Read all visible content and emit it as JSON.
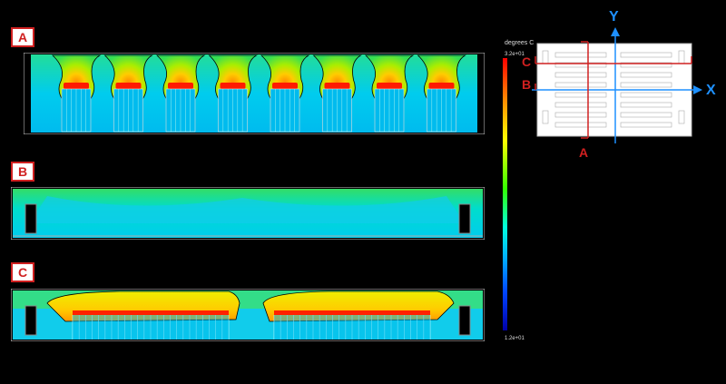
{
  "panels": [
    {
      "label": "A"
    },
    {
      "label": "B"
    },
    {
      "label": "C"
    }
  ],
  "colorbar": {
    "title": "degrees C",
    "max": "3.2e+01",
    "min": "1.2e+01",
    "colors": [
      "#ff0000",
      "#ff8800",
      "#ffff00",
      "#33ff00",
      "#00ffdd",
      "#00aaff",
      "#0044ff",
      "#0000aa"
    ]
  },
  "keyplan": {
    "y_axis": "Y",
    "x_axis": "X",
    "section_a": "A",
    "section_b": "B",
    "section_c": "C"
  }
}
